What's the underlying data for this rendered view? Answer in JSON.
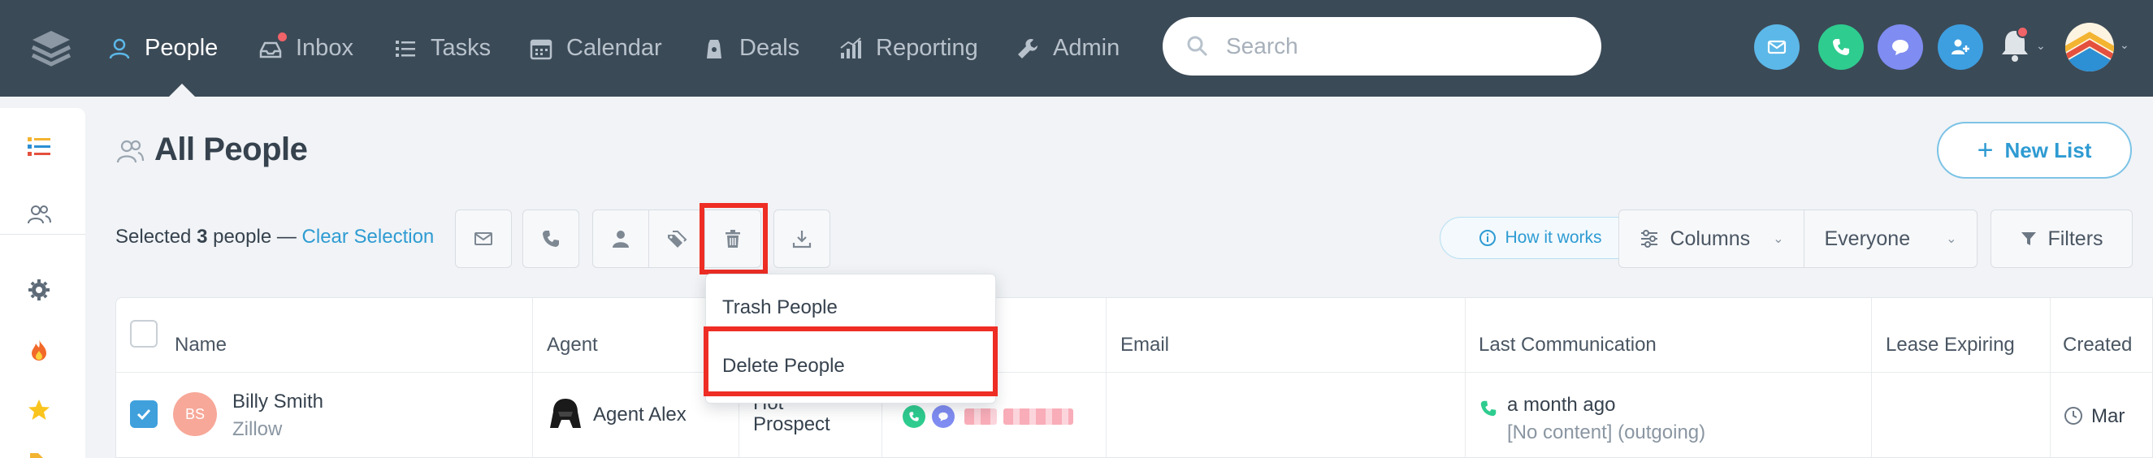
{
  "nav": {
    "items": [
      {
        "label": "People",
        "icon": "person-icon"
      },
      {
        "label": "Inbox",
        "icon": "inbox-icon"
      },
      {
        "label": "Tasks",
        "icon": "tasks-icon"
      },
      {
        "label": "Calendar",
        "icon": "calendar-icon"
      },
      {
        "label": "Deals",
        "icon": "deals-icon"
      },
      {
        "label": "Reporting",
        "icon": "reporting-icon"
      },
      {
        "label": "Admin",
        "icon": "wrench-icon"
      }
    ],
    "search_placeholder": "Search",
    "colors": {
      "bar": "#3b4a57",
      "email": "#5cb8e8",
      "phone": "#2ecc8f",
      "chat": "#7f8cf2",
      "add_contact": "#3d9fe0",
      "notification_dot": "#f06368"
    }
  },
  "header": {
    "title": "All People",
    "new_list_label": "New List"
  },
  "toolbar": {
    "selected_prefix": "Selected",
    "selected_count": "3",
    "selected_suffix": "people —",
    "clear_selection": "Clear Selection",
    "how_it_works": "How it works",
    "columns_label": "Columns",
    "everyone_label": "Everyone",
    "filters_label": "Filters"
  },
  "dropdown": {
    "items": [
      "Trash People",
      "Delete People"
    ]
  },
  "table": {
    "headers": [
      "Name",
      "Agent",
      "Email",
      "Last Communication",
      "Lease Expiring",
      "Created"
    ],
    "rows": [
      {
        "initials": "BS",
        "name": "Billy Smith",
        "source": "Zillow",
        "agent": "Agent Alex",
        "stage_line1": "Hot",
        "stage_line2": "Prospect",
        "last_comm": "a month ago",
        "last_comm_detail": "[No content] (outgoing)",
        "created": "Mar"
      }
    ]
  }
}
